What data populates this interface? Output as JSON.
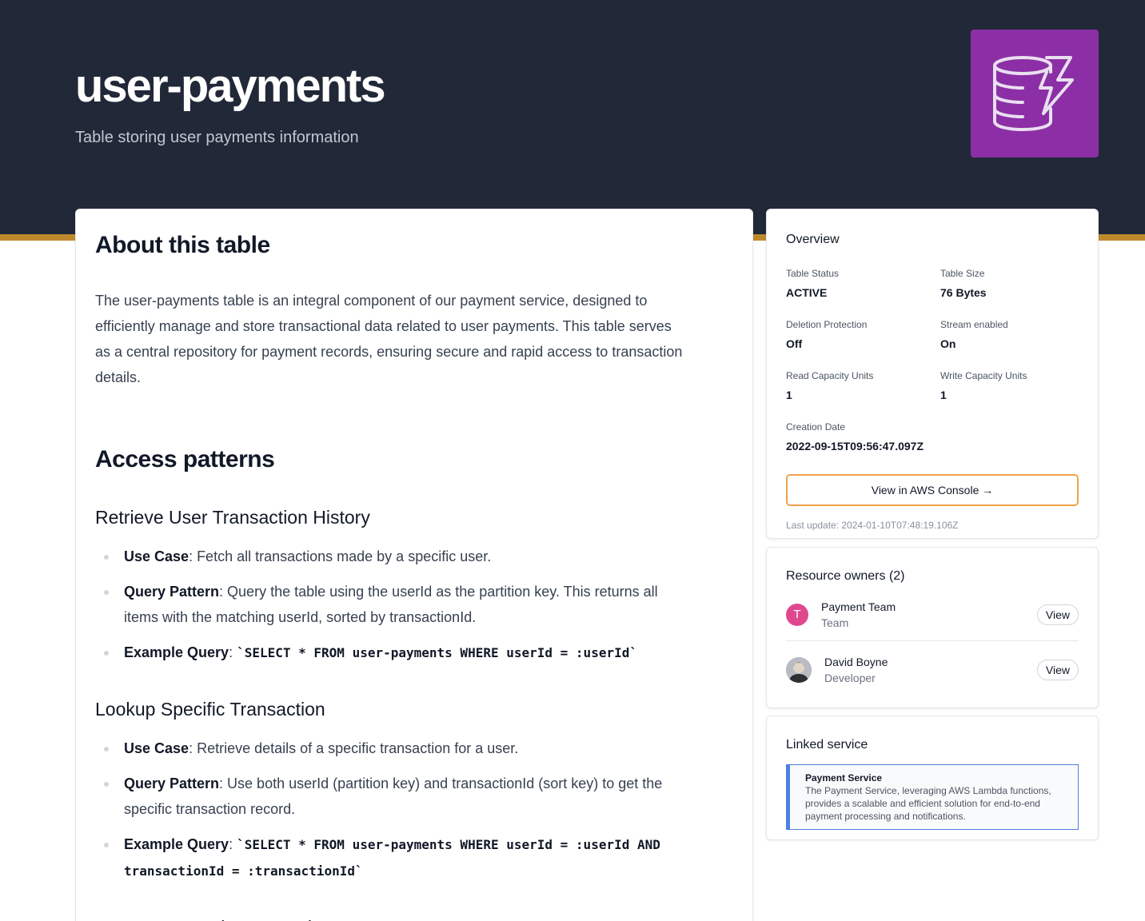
{
  "header": {
    "title": "user-payments",
    "subtitle": "Table storing user payments information",
    "icon": "dynamodb-table-icon",
    "icon_bg": "#8c2fa6",
    "hero_bg": "#212838",
    "accent": "#bf8a2e"
  },
  "about": {
    "heading": "About this table",
    "text": "The user-payments table is an integral component of our payment service, designed to efficiently manage and store transactional data related to user payments. This table serves as a central repository for payment records, ensuring secure and rapid access to transaction details."
  },
  "access": {
    "heading": "Access patterns",
    "patterns": [
      {
        "title": "Retrieve User Transaction History",
        "use_case_label": "Use Case",
        "use_case": ": Fetch all transactions made by a specific user.",
        "query_pattern_label": "Query Pattern",
        "query_pattern": ": Query the table using the userId as the partition key. This returns all items with the matching userId, sorted by transactionId.",
        "example_label": "Example Query",
        "example_sep": ": ",
        "example": "`SELECT * FROM user-payments WHERE userId = :userId`"
      },
      {
        "title": "Lookup Specific Transaction",
        "use_case_label": "Use Case",
        "use_case": ": Retrieve details of a specific transaction for a user.",
        "query_pattern_label": "Query Pattern",
        "query_pattern": ": Use both userId (partition key) and transactionId (sort key) to get the specific transaction record.",
        "example_label": "Example Query",
        "example_sep": ": ",
        "example": "`SELECT * FROM user-payments WHERE userId = :userId AND transactionId = :transactionId`"
      },
      {
        "title": "Query Transactions Based on Status"
      }
    ]
  },
  "overview": {
    "title": "Overview",
    "fields": [
      {
        "label": "Table Status",
        "value": "ACTIVE"
      },
      {
        "label": "Table Size",
        "value": "76 Bytes"
      },
      {
        "label": "Deletion Protection",
        "value": "Off"
      },
      {
        "label": "Stream enabled",
        "value": "On"
      },
      {
        "label": "Read Capacity Units",
        "value": "1"
      },
      {
        "label": "Write Capacity Units",
        "value": "1"
      },
      {
        "label": "Creation Date",
        "value": "2022-09-15T09:56:47.097Z"
      }
    ],
    "console_button": "View in AWS Console →",
    "last_update": "Last update: 2024-01-10T07:48:19.106Z"
  },
  "owners": {
    "title": "Resource owners (2)",
    "items": [
      {
        "initial": "T",
        "name": "Payment Team",
        "type": "Team",
        "button": "View",
        "avatar_color": "#e0488e"
      },
      {
        "name": "David Boyne",
        "type": "Developer",
        "button": "View"
      }
    ]
  },
  "linked": {
    "title": "Linked service",
    "service_name": "Payment Service",
    "service_desc": "The Payment Service, leveraging AWS Lambda functions, provides a scalable and efficient solution for end-to-end payment processing and notifications."
  }
}
